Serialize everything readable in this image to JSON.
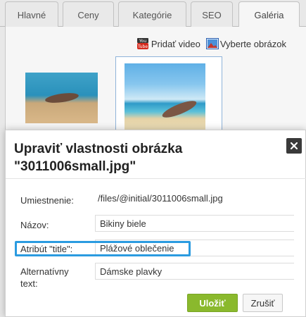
{
  "tabs": [
    {
      "label": "Hlavné",
      "active": false
    },
    {
      "label": "Ceny",
      "active": false
    },
    {
      "label": "Kategórie",
      "active": false
    },
    {
      "label": "SEO",
      "active": false
    },
    {
      "label": "Galéria",
      "active": true
    }
  ],
  "media_actions": {
    "add_video": "Pridať video",
    "choose_image": "Vyberte obrázok"
  },
  "dialog": {
    "title_line1": "Upraviť vlastnosti obrázka",
    "title_line2": "\"3011006small.jpg\"",
    "fields": {
      "location_label": "Umiestnenie:",
      "location_value": "/files/@initial/3011006small.jpg",
      "name_label": "Názov:",
      "name_value": "Bikiny biele",
      "title_attr_label": "Atribút \"title\":",
      "title_attr_value": "Plážové oblečenie",
      "alt_label_line1": "Alternatívny",
      "alt_label_line2": "text:",
      "alt_value": "Dámske plavky"
    },
    "save_label": "Uložiť",
    "cancel_label": "Zrušiť"
  },
  "colors": {
    "accent_save": "#8ab92d",
    "highlight": "#2b9be0"
  }
}
